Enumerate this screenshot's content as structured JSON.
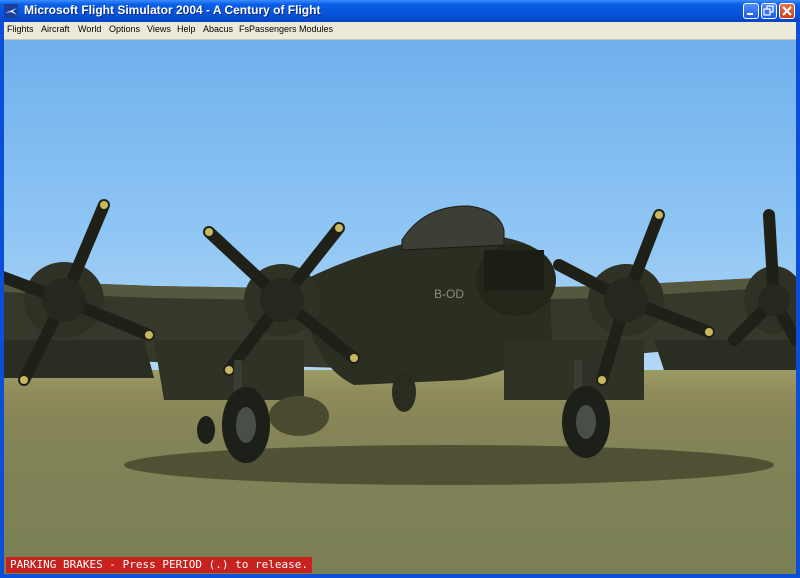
{
  "window": {
    "title": "Microsoft Flight Simulator 2004 - A Century of Flight"
  },
  "menu": {
    "items": [
      "Flights",
      "Aircraft",
      "World",
      "Options",
      "Views",
      "Help",
      "Abacus",
      "FsPassengers",
      "Modules"
    ]
  },
  "scene": {
    "aircraft_code": "B-OD",
    "colors": {
      "sky_top": "#6fb0ec",
      "sky_horizon": "#b6d9f6",
      "ground": "#848457",
      "aircraft": "#2b2f22",
      "status_bg": "#c8221e"
    }
  },
  "status": {
    "message": "PARKING BRAKES - Press PERIOD (.) to release."
  }
}
